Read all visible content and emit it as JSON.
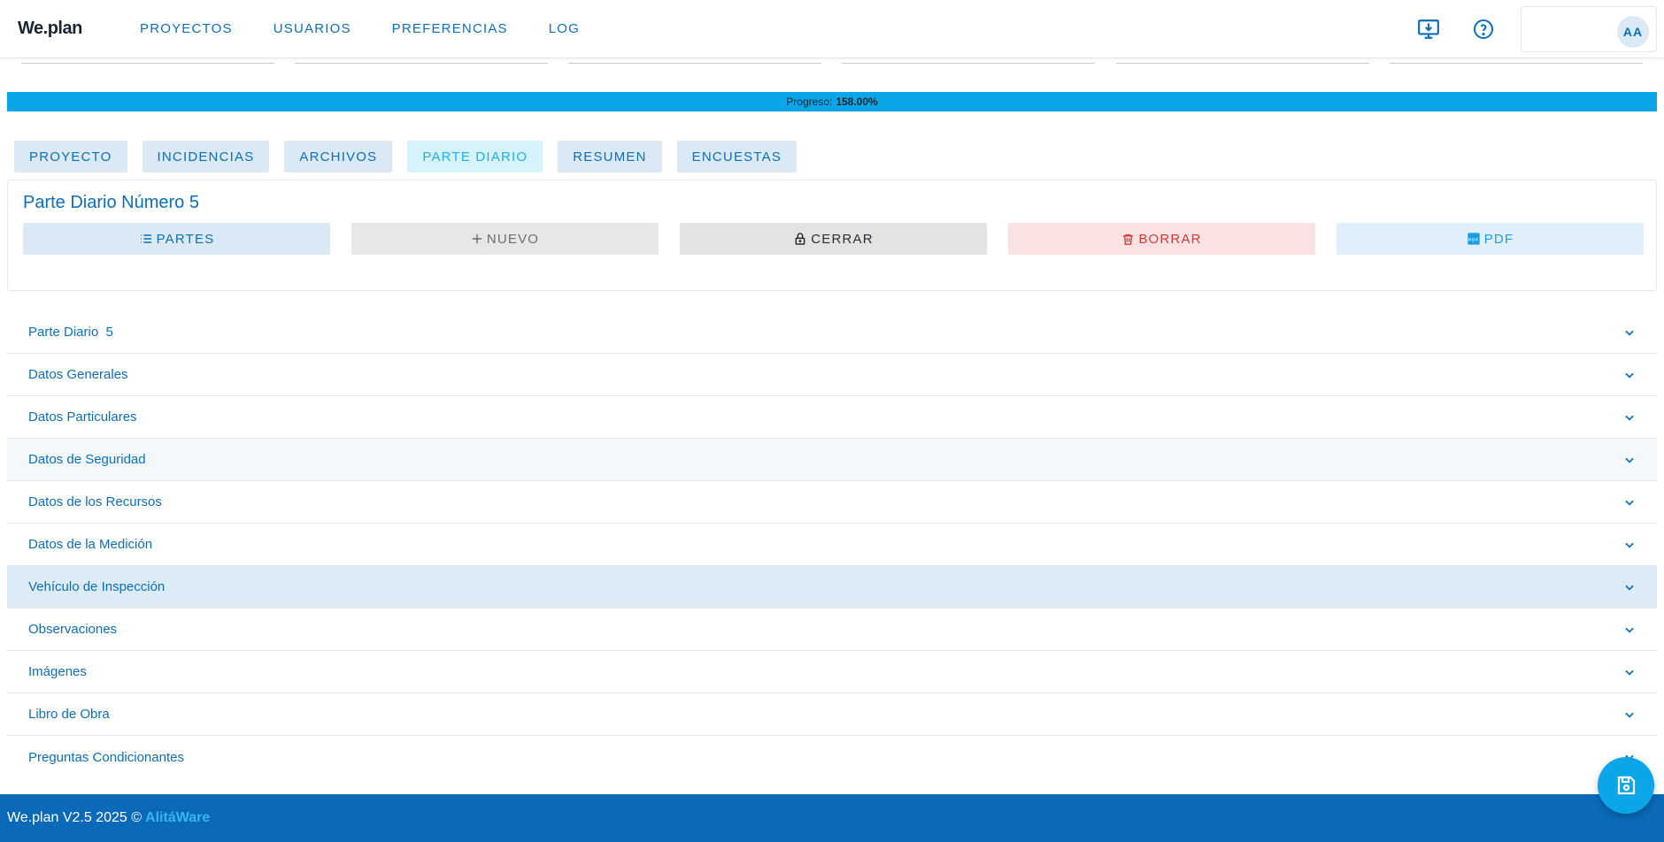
{
  "app": {
    "logo": "We.plan"
  },
  "nav": [
    {
      "label": "PROYECTOS"
    },
    {
      "label": "USUARIOS"
    },
    {
      "label": "PREFERENCIAS"
    },
    {
      "label": "LOG"
    }
  ],
  "user": {
    "initials": "AA"
  },
  "progress": {
    "label": "Progreso:",
    "value": "158.00%",
    "fraction": 1.0
  },
  "tabs": [
    {
      "label": "PROYECTO"
    },
    {
      "label": "INCIDENCIAS"
    },
    {
      "label": "ARCHIVOS"
    },
    {
      "label": "PARTE DIARIO",
      "active": true
    },
    {
      "label": "RESUMEN"
    },
    {
      "label": "ENCUESTAS"
    }
  ],
  "card": {
    "title": "Parte Diario Número 5",
    "actions": {
      "partes": "PARTES",
      "nuevo": "NUEVO",
      "cerrar": "CERRAR",
      "borrar": "BORRAR",
      "pdf": "PDF"
    }
  },
  "sections": [
    {
      "label": "Parte Diario  5"
    },
    {
      "label": "Datos Generales"
    },
    {
      "label": "Datos Particulares"
    },
    {
      "label": "Datos de Seguridad"
    },
    {
      "label": "Datos de los Recursos"
    },
    {
      "label": "Datos de la Medición"
    },
    {
      "label": "Vehículo de Inspección"
    },
    {
      "label": "Observaciones"
    },
    {
      "label": "Imágenes"
    },
    {
      "label": "Libro de Obra"
    },
    {
      "label": "Preguntas Condicionantes"
    }
  ],
  "footer": {
    "text": "We.plan V2.5 2025 ©",
    "brand": "AlitáWare"
  },
  "colors": {
    "primary": "#0d6fb8",
    "accent": "#0aa6e8",
    "footer": "#0a6ab8",
    "danger": "#d23a3a"
  }
}
